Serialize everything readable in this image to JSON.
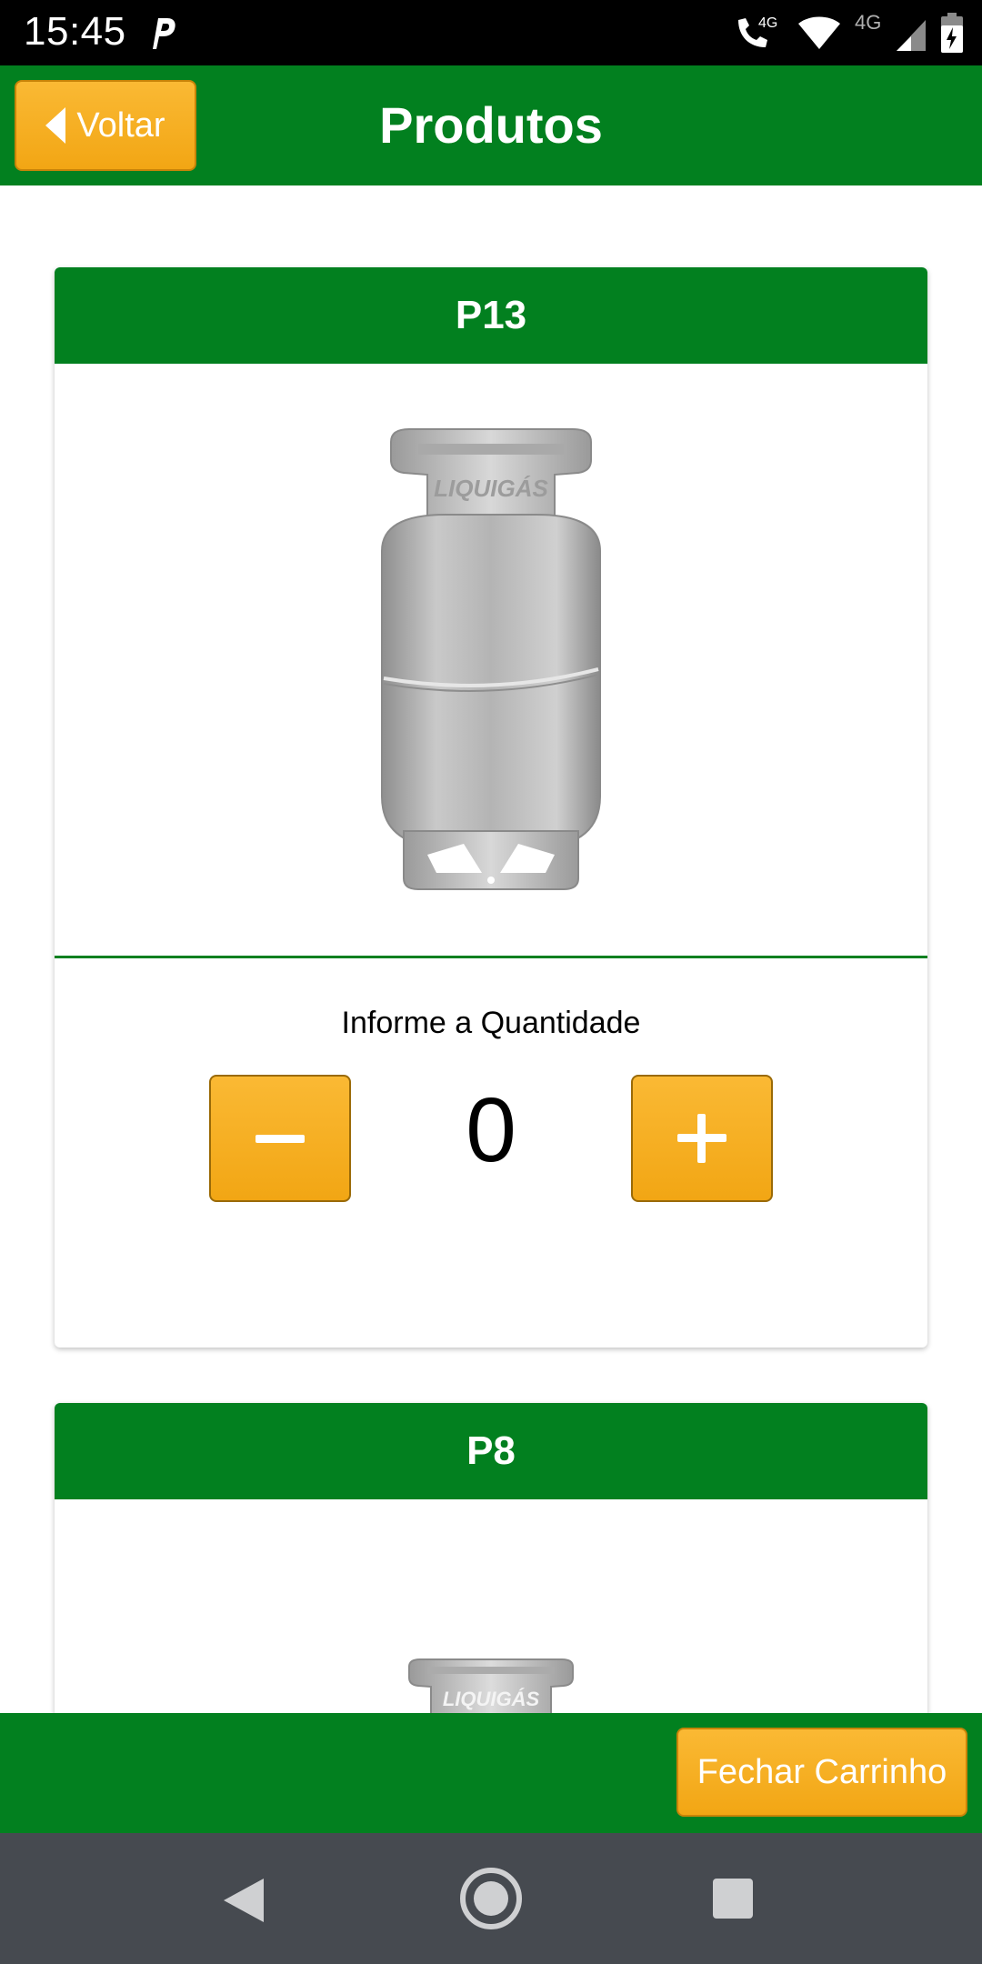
{
  "status_bar": {
    "time": "15:45",
    "network_label_1": "4G",
    "network_label_2": "4G",
    "icons": [
      "parking-app-icon",
      "wifi-calling-icon",
      "wifi-icon",
      "cellular-signal-icon",
      "battery-charging-icon"
    ]
  },
  "header": {
    "back_label": "Voltar",
    "title": "Produtos"
  },
  "products": [
    {
      "name": "P13",
      "image_brand_text": "LIQUIGÁS",
      "quantity_label": "Informe a Quantidade",
      "quantity": "0"
    },
    {
      "name": "P8",
      "image_brand_text": "LIQUIGÁS"
    }
  ],
  "footer": {
    "checkout_label": "Fechar Carrinho"
  },
  "colors": {
    "primary_green": "#02801f",
    "accent_orange": "#f2a614",
    "nav_bar": "#464a50"
  }
}
